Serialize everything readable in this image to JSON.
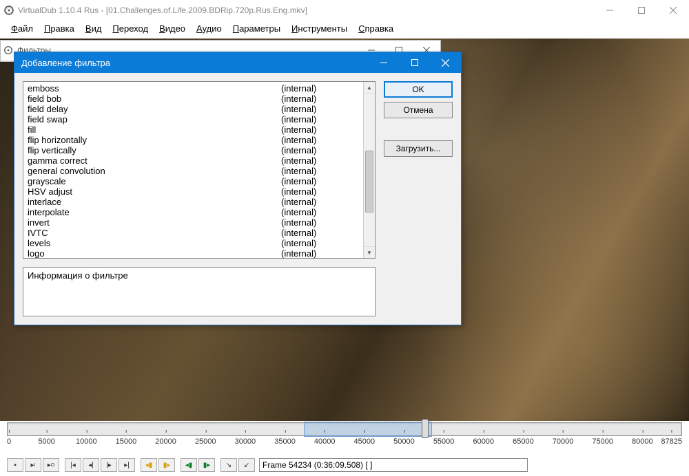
{
  "window": {
    "title": "VirtualDub 1.10.4 Rus - [01.Challenges.of.Life.2009.BDRip.720p.Rus.Eng.mkv]"
  },
  "menu": {
    "items": [
      "Файл",
      "Правка",
      "Вид",
      "Переход",
      "Видео",
      "Аудио",
      "Параметры",
      "Инструменты",
      "Справка"
    ]
  },
  "filters_dialog": {
    "title": "Фильтры"
  },
  "addfilter_dialog": {
    "title": "Добавление фильтра",
    "info_label": "Информация о фильтре",
    "buttons": {
      "ok": "OK",
      "cancel": "Отмена",
      "load": "Загрузить..."
    },
    "filters": [
      {
        "name": "emboss",
        "origin": "(internal)"
      },
      {
        "name": "field bob",
        "origin": "(internal)"
      },
      {
        "name": "field delay",
        "origin": "(internal)"
      },
      {
        "name": "field swap",
        "origin": "(internal)"
      },
      {
        "name": "fill",
        "origin": "(internal)"
      },
      {
        "name": "flip horizontally",
        "origin": "(internal)"
      },
      {
        "name": "flip vertically",
        "origin": "(internal)"
      },
      {
        "name": "gamma correct",
        "origin": "(internal)"
      },
      {
        "name": "general convolution",
        "origin": "(internal)"
      },
      {
        "name": "grayscale",
        "origin": "(internal)"
      },
      {
        "name": "HSV adjust",
        "origin": "(internal)"
      },
      {
        "name": "interlace",
        "origin": "(internal)"
      },
      {
        "name": "interpolate",
        "origin": "(internal)"
      },
      {
        "name": "invert",
        "origin": "(internal)"
      },
      {
        "name": "IVTC",
        "origin": "(internal)"
      },
      {
        "name": "levels",
        "origin": "(internal)"
      },
      {
        "name": "logo",
        "origin": "(internal)"
      }
    ]
  },
  "timeline": {
    "ticks": [
      "0",
      "5000",
      "10000",
      "15000",
      "20000",
      "25000",
      "30000",
      "35000",
      "40000",
      "45000",
      "50000",
      "55000",
      "60000",
      "65000",
      "70000",
      "75000",
      "80000",
      "87825"
    ],
    "selection_start_pct": 44,
    "selection_end_pct": 63,
    "marker_pct": 62
  },
  "status": {
    "frame_text": "Frame 54234 (0:36:09.508) [ ]"
  }
}
